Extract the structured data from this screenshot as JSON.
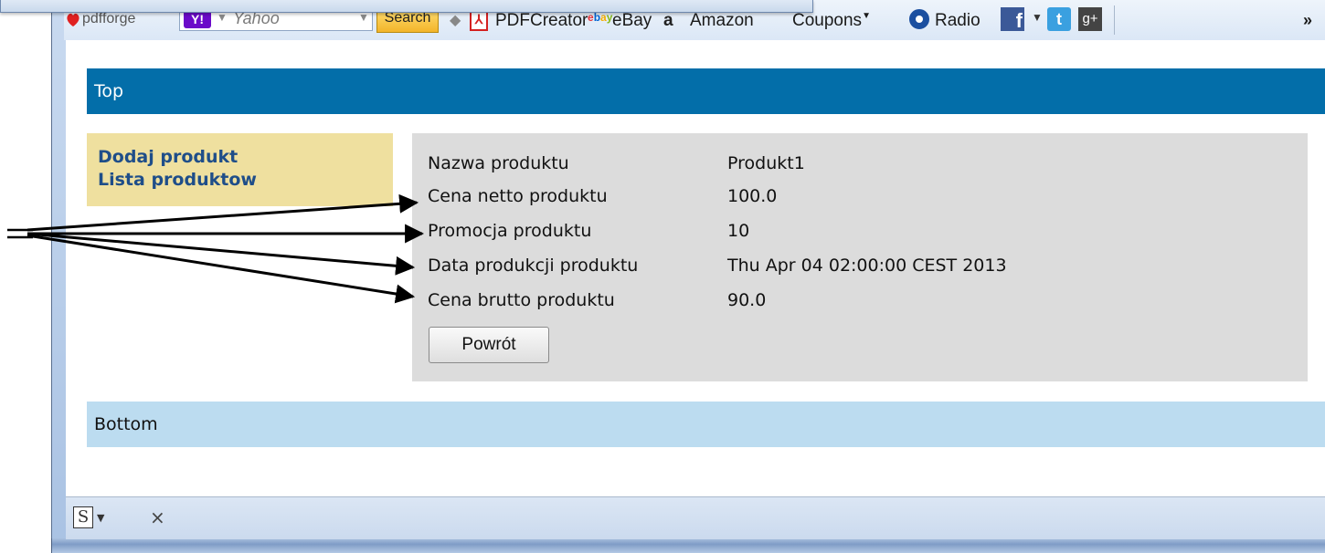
{
  "toolbar": {
    "pdfforge_label": "pdfforge",
    "yahoo_logo": "Y!",
    "yahoo_text": "Yahoo",
    "search_label": "Search",
    "pdfcreator_label": "PDFCreator",
    "ebay_icon": "ebay",
    "ebay_label": "eBay",
    "amazon_icon": "a",
    "amazon_label": "Amazon",
    "coupons_label": "Coupons",
    "radio_label": "Radio",
    "facebook_icon": "f",
    "twitter_icon": "t",
    "gplus_icon": "g+",
    "overflow_label": "»"
  },
  "page": {
    "top_label": "Top",
    "bottom_label": "Bottom",
    "sidebar": {
      "links": [
        "Dodaj produkt",
        "Lista produktow"
      ]
    },
    "details": {
      "rows": [
        {
          "label": "Nazwa produktu",
          "value": "Produkt1"
        },
        {
          "label": "Cena netto produktu",
          "value": "100.0"
        },
        {
          "label": "Promocja produktu",
          "value": "10"
        },
        {
          "label": "Data produkcji produktu",
          "value": "Thu Apr 04 02:00:00 CEST 2013"
        },
        {
          "label": "Cena brutto produktu",
          "value": "90.0"
        }
      ],
      "back_label": "Powrót"
    }
  },
  "statusbar": {
    "s_icon": "S",
    "close_label": "×"
  },
  "colors": {
    "top_bar": "#036ea9",
    "bottom_bar": "#bcdcf0",
    "sidebar": "#efe09f",
    "details_panel": "#dcdcdc",
    "link": "#1f4e89"
  }
}
